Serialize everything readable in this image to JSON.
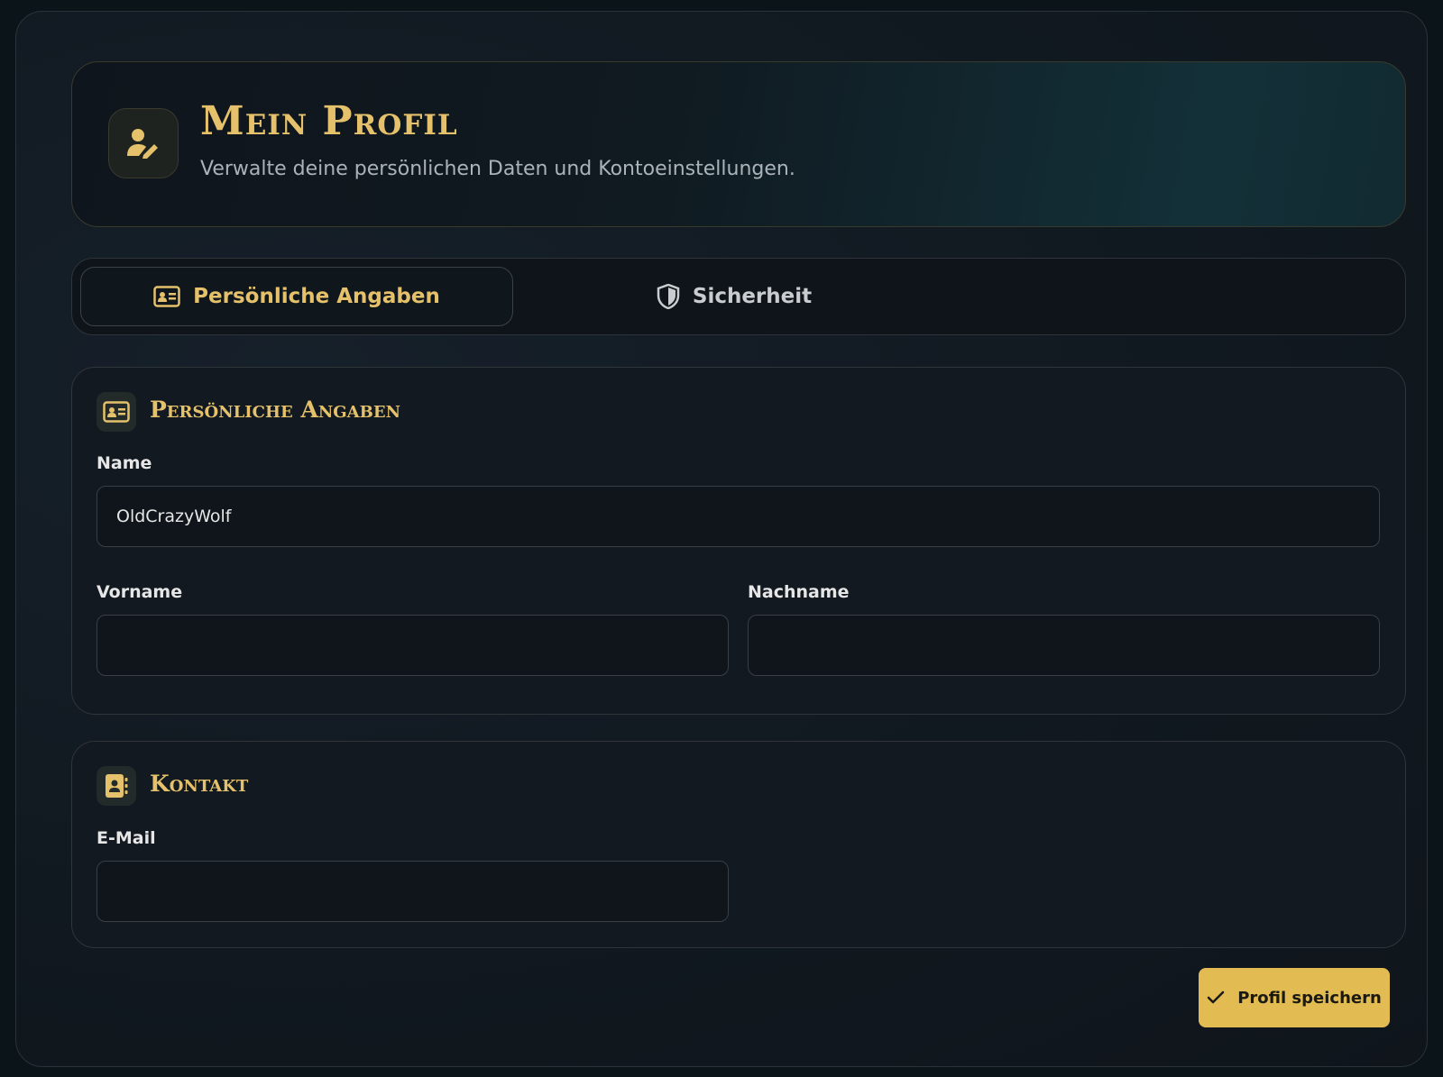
{
  "header": {
    "title": "Mein Profil",
    "subtitle": "Verwalte deine persönlichen Daten und Kontoeinstellungen.",
    "icon": "user-edit-icon"
  },
  "tabs": [
    {
      "label": "Persönliche Angaben",
      "icon": "id-card-icon",
      "active": true
    },
    {
      "label": "Sicherheit",
      "icon": "shield-icon",
      "active": false
    }
  ],
  "personal": {
    "title": "Persönliche Angaben",
    "icon": "id-card-icon",
    "name_label": "Name",
    "name_value": "OldCrazyWolf",
    "firstname_label": "Vorname",
    "firstname_value": "",
    "lastname_label": "Nachname",
    "lastname_value": ""
  },
  "contact": {
    "title": "Kontakt",
    "icon": "contact-book-icon",
    "email_label": "E-Mail",
    "email_value": ""
  },
  "actions": {
    "save_label": "Profil speichern",
    "save_icon": "check-icon"
  },
  "colors": {
    "accent": "#e4c16a",
    "button": "#e2bc53",
    "background": "#111920"
  }
}
